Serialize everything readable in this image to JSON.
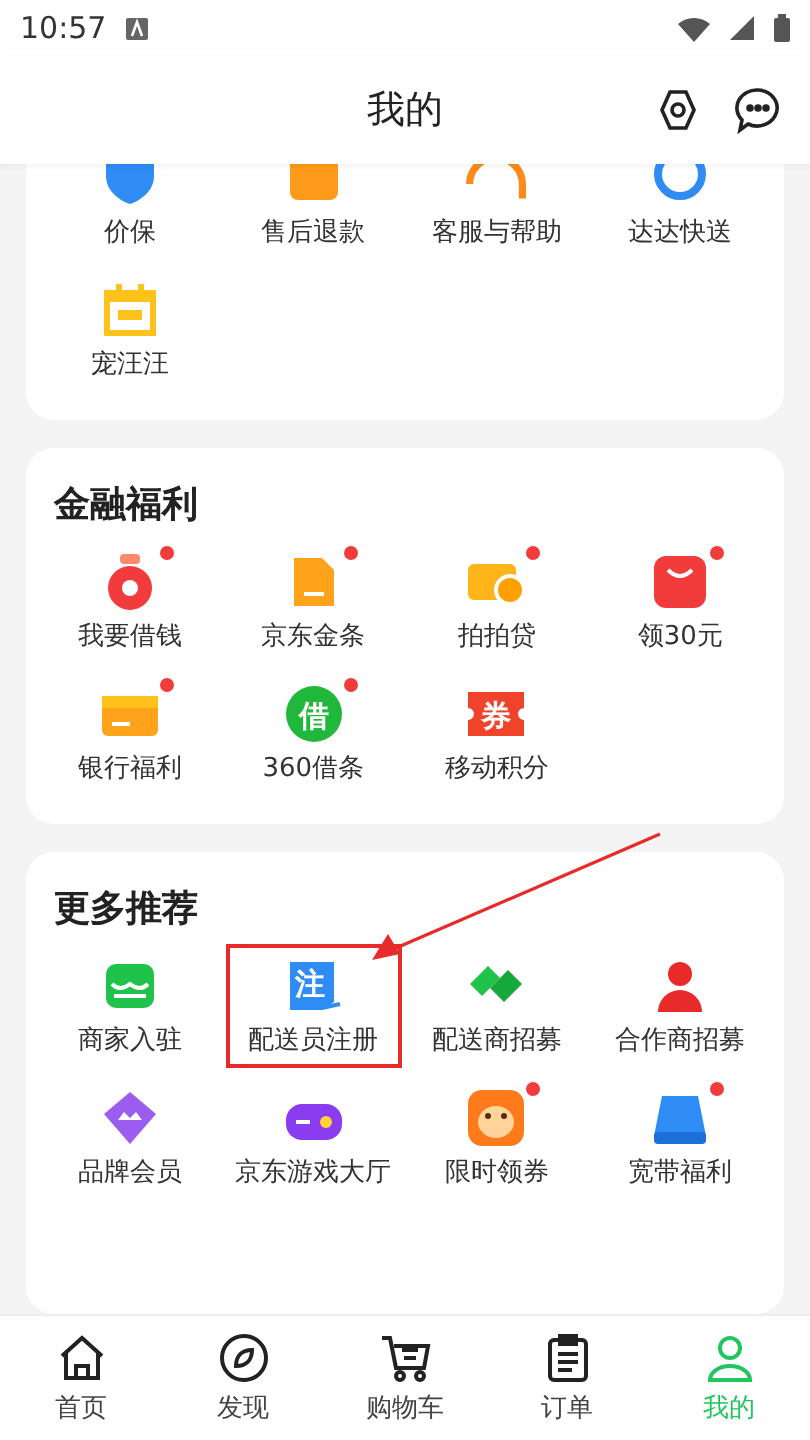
{
  "status_bar": {
    "time": "10:57"
  },
  "header": {
    "title": "我的"
  },
  "sections": [
    {
      "items": [
        {
          "label": "价保",
          "badge": false,
          "highlighted": false
        },
        {
          "label": "售后退款",
          "badge": false,
          "highlighted": false
        },
        {
          "label": "客服与帮助",
          "badge": false,
          "highlighted": false
        },
        {
          "label": "达达快送",
          "badge": false,
          "highlighted": false
        },
        {
          "label": "宠汪汪",
          "badge": false,
          "highlighted": false
        }
      ]
    },
    {
      "title": "金融福利",
      "items": [
        {
          "label": "我要借钱",
          "badge": true,
          "highlighted": false
        },
        {
          "label": "京东金条",
          "badge": true,
          "highlighted": false
        },
        {
          "label": "拍拍贷",
          "badge": true,
          "highlighted": false
        },
        {
          "label": "领30元",
          "badge": true,
          "highlighted": false
        },
        {
          "label": "银行福利",
          "badge": true,
          "highlighted": false
        },
        {
          "label": "360借条",
          "glyph": "借",
          "badge": true,
          "highlighted": false
        },
        {
          "label": "移动积分",
          "glyph": "券",
          "badge": false,
          "highlighted": false
        }
      ]
    },
    {
      "title": "更多推荐",
      "items": [
        {
          "label": "商家入驻",
          "badge": false,
          "highlighted": false
        },
        {
          "label": "配送员注册",
          "glyph": "注",
          "badge": false,
          "highlighted": true
        },
        {
          "label": "配送商招募",
          "badge": false,
          "highlighted": false
        },
        {
          "label": "合作商招募",
          "badge": false,
          "highlighted": false
        },
        {
          "label": "品牌会员",
          "badge": false,
          "highlighted": false
        },
        {
          "label": "京东游戏大厅",
          "badge": false,
          "highlighted": false
        },
        {
          "label": "限时领券",
          "badge": true,
          "highlighted": false
        },
        {
          "label": "宽带福利",
          "badge": true,
          "highlighted": false
        }
      ]
    }
  ],
  "bottom_nav": [
    {
      "label": "首页",
      "selected": false
    },
    {
      "label": "发现",
      "selected": false
    },
    {
      "label": "购物车",
      "selected": false
    },
    {
      "label": "订单",
      "selected": false
    },
    {
      "label": "我的",
      "selected": true
    }
  ]
}
